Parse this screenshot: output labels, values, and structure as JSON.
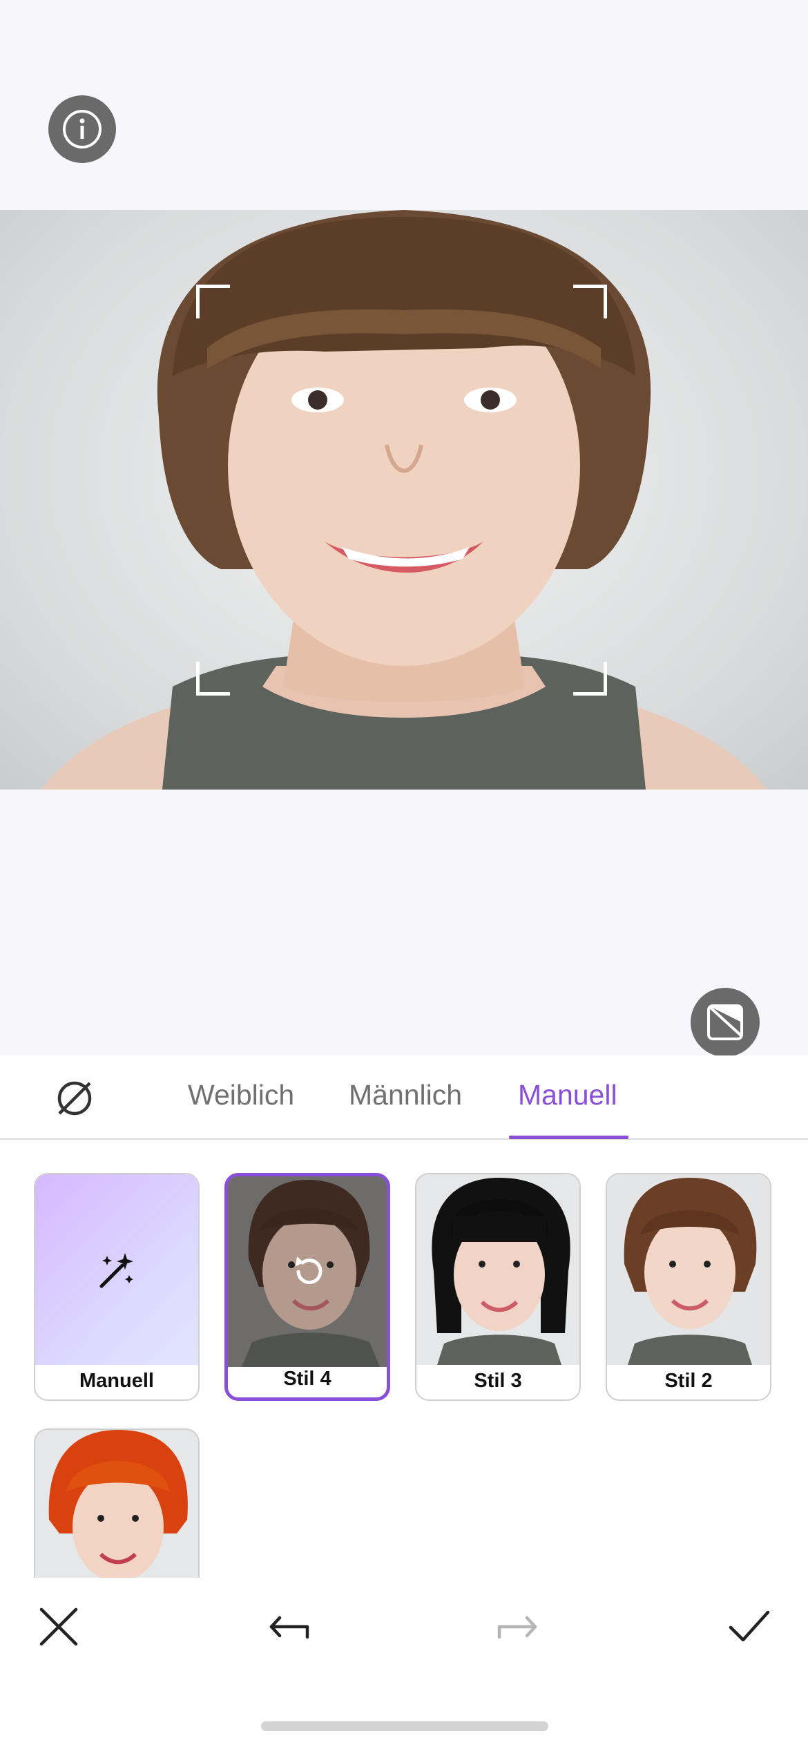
{
  "colors": {
    "accent": "#8a4fd8",
    "icon_bg": "#6a6a6a"
  },
  "top": {
    "info_icon": "info-icon"
  },
  "photo": {
    "compare_icon": "compare-icon"
  },
  "tabs": {
    "none_icon": "none-icon",
    "items": [
      {
        "label": "Weiblich"
      },
      {
        "label": "Männlich"
      },
      {
        "label": "Manuell"
      }
    ],
    "active": "Manuell"
  },
  "styles": [
    {
      "label": "Manuell",
      "icon": "magic-wand-icon"
    },
    {
      "label": "Stil 4",
      "selected": true,
      "icon": "reset-icon"
    },
    {
      "label": "Stil 3"
    },
    {
      "label": "Stil 2"
    },
    {
      "label": ""
    }
  ],
  "toolbar": {
    "close_icon": "close-icon",
    "undo_icon": "undo-icon",
    "redo_icon": "redo-icon",
    "confirm_icon": "check-icon"
  }
}
